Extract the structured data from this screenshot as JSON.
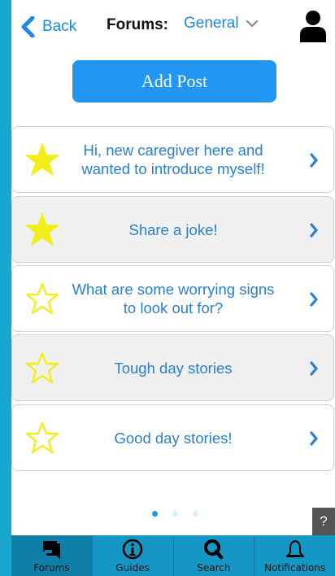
{
  "header": {
    "back_label": "Back",
    "forums_label": "Forums:",
    "forum_selected": "General"
  },
  "add_post_label": "Add Post",
  "posts": [
    {
      "title": "Hi, new caregiver here and wanted to introduce myself!",
      "starred": true
    },
    {
      "title": "Share a joke!",
      "starred": true
    },
    {
      "title": "What are some worrying signs to look out for?",
      "starred": false
    },
    {
      "title": "Tough day stories",
      "starred": false
    },
    {
      "title": "Good day stories!",
      "starred": false
    }
  ],
  "pagination": {
    "page_count": 3,
    "current_page": 1
  },
  "help_label": "?",
  "tabs": [
    {
      "label": "Forums",
      "icon": "forums-icon",
      "active": true
    },
    {
      "label": "Guides",
      "icon": "info-icon",
      "active": false
    },
    {
      "label": "Search",
      "icon": "search-icon",
      "active": false
    },
    {
      "label": "Notifications",
      "icon": "bell-icon",
      "active": false
    }
  ],
  "colors": {
    "accent": "#2196f3",
    "link_blue": "#2a7fd0",
    "star_yellow": "#f2ee1c",
    "tabbar": "#1597c5",
    "frame": "#17a7cf"
  }
}
